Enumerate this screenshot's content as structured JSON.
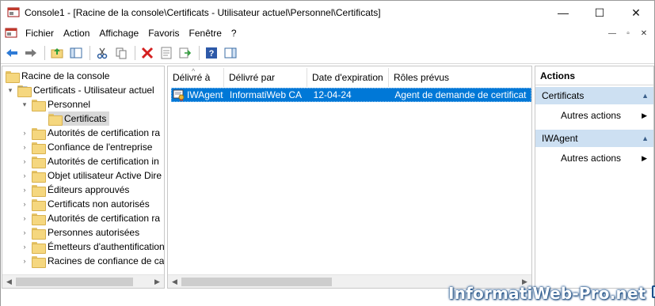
{
  "window": {
    "title": "Console1 - [Racine de la console\\Certificats - Utilisateur actuel\\Personnel\\Certificats]",
    "minimize": "—",
    "maximize": "☐",
    "close": "✕"
  },
  "menu": {
    "items": [
      "Fichier",
      "Action",
      "Affichage",
      "Favoris",
      "Fenêtre",
      "?"
    ],
    "mdi": [
      "—",
      "▫",
      "✕"
    ]
  },
  "toolbar": {
    "buttons": [
      "back-icon",
      "forward-icon",
      "up-folder-icon",
      "show-tree-icon",
      "cut-icon",
      "copy-icon",
      "delete-icon",
      "properties-icon",
      "export-icon",
      "help-icon",
      "action-pane-icon"
    ]
  },
  "tree": {
    "root": "Racine de la console",
    "store": "Certificats - Utilisateur actuel",
    "personal": "Personnel",
    "certs": "Certificats",
    "folders": [
      "Autorités de certification ra",
      "Confiance de l'entreprise",
      "Autorités de certification in",
      "Objet utilisateur Active Dire",
      "Éditeurs approuvés",
      "Certificats non autorisés",
      "Autorités de certification ra",
      "Personnes autorisées",
      "Émetteurs d'authentification",
      "Racines de confiance de ca"
    ]
  },
  "list": {
    "columns": [
      "Délivré à",
      "Délivré par",
      "Date d'expiration",
      "Rôles prévus"
    ],
    "rows": [
      {
        "issued_to": "IWAgent",
        "issued_by": "InformatiWeb CA",
        "expiration": "12-04-24",
        "roles": "Agent de demande de certificat"
      }
    ]
  },
  "actions": {
    "header": "Actions",
    "sections": [
      {
        "title": "Certificats",
        "item": "Autres actions"
      },
      {
        "title": "IWAgent",
        "item": "Autres actions"
      }
    ]
  },
  "watermark": {
    "text": "InformatiWeb-Pro.net"
  },
  "colors": {
    "selection": "#0078d7",
    "action_section": "#cde0f2",
    "folder": "#f5d77f"
  }
}
